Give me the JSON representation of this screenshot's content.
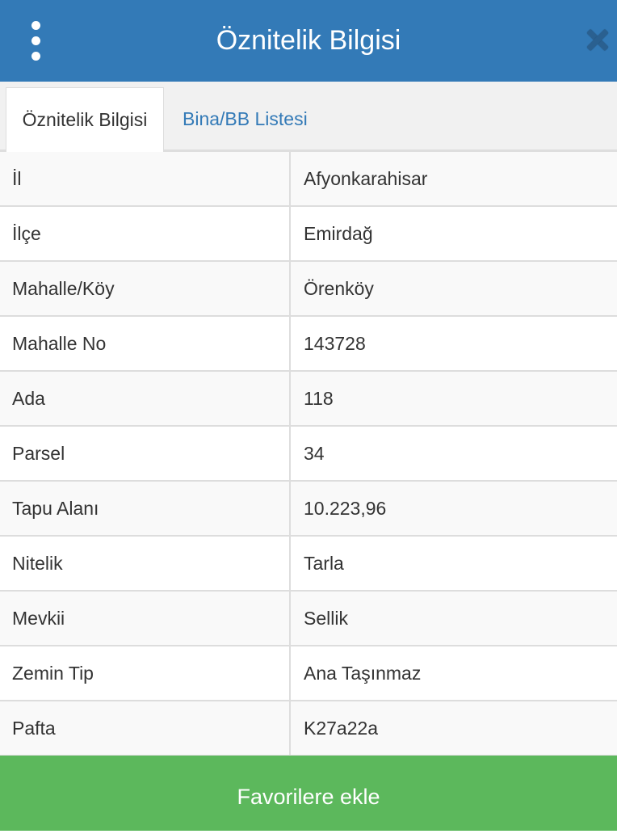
{
  "header": {
    "title": "Öznitelik Bilgisi",
    "menu_icon": "vertical-ellipsis-icon",
    "close_icon": "close-icon",
    "background_color": "#337ab7"
  },
  "tabs": [
    {
      "label": "Öznitelik Bilgisi",
      "active": true
    },
    {
      "label": "Bina/BB Listesi",
      "active": false
    }
  ],
  "attributes": [
    {
      "label": "İl",
      "value": "Afyonkarahisar"
    },
    {
      "label": "İlçe",
      "value": "Emirdağ"
    },
    {
      "label": "Mahalle/Köy",
      "value": "Örenköy"
    },
    {
      "label": "Mahalle No",
      "value": "143728"
    },
    {
      "label": "Ada",
      "value": "118"
    },
    {
      "label": "Parsel",
      "value": "34"
    },
    {
      "label": "Tapu Alanı",
      "value": "10.223,96"
    },
    {
      "label": "Nitelik",
      "value": "Tarla"
    },
    {
      "label": "Mevkii",
      "value": "Sellik"
    },
    {
      "label": "Zemin Tip",
      "value": "Ana Taşınmaz"
    },
    {
      "label": "Pafta",
      "value": "K27a22a"
    }
  ],
  "footer": {
    "favorite_label": "Favorilere ekle",
    "button_color": "#5cb85c"
  }
}
